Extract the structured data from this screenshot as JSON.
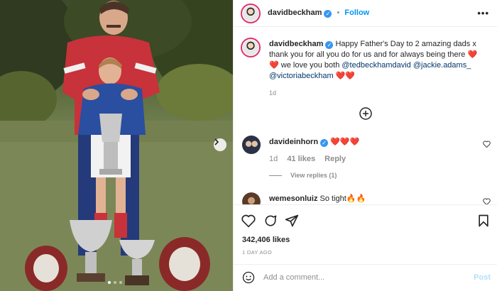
{
  "post": {
    "author": "davidbeckham",
    "follow_label": "Follow",
    "more_label": "•••",
    "caption": {
      "username": "davidbeckham",
      "text_part1": "Happy Father's Day to 2 amazing dads x thank you for all you do for us and for always being there",
      "hearts_1": "❤️❤️",
      "text_part2": "we love you both",
      "mention_1": "@tedbeckhamdavid",
      "mention_2": "@jackie.adams_",
      "mention_3": "@victoriabeckham",
      "hearts_2": "❤️❤️",
      "time": "1d"
    },
    "comments": [
      {
        "username": "davideinhorn",
        "text": "❤️❤️❤️",
        "time": "1d",
        "likes": "41 likes",
        "reply_label": "Reply",
        "view_replies": "View replies (1)"
      },
      {
        "username": "wemesonluiz",
        "text": "So tight🔥🔥"
      }
    ],
    "likes": "342,406 likes",
    "posted_ago": "1 DAY AGO",
    "add_comment_placeholder": "Add a comment...",
    "post_button": "Post"
  },
  "carousel": {
    "slides": 3,
    "active": 0
  },
  "icons": {
    "verified": "verified-badge-icon",
    "next": "chevron-right-icon",
    "load_more": "plus-circle-icon",
    "like": "heart-outline-icon",
    "comment": "comment-icon",
    "share": "paper-plane-icon",
    "save": "bookmark-icon",
    "emoji": "smiley-icon"
  },
  "colors": {
    "link_blue": "#0095f6",
    "verified_blue": "#3897f0",
    "heart_red": "#ed4956",
    "meta_gray": "#8e8e8e"
  }
}
